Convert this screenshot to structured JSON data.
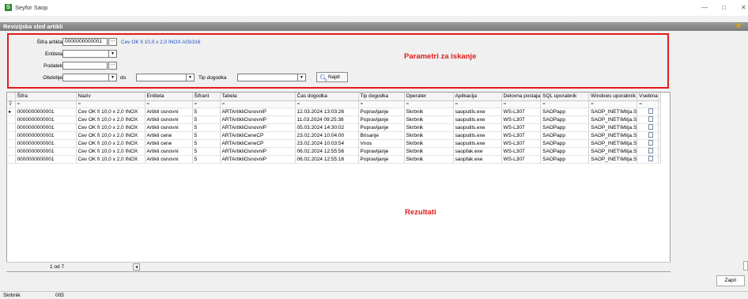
{
  "window": {
    "app_name": "Seyfor Saop",
    "logo_letter": "S"
  },
  "subbar": {
    "title": "Revizijska sled artikli"
  },
  "params": {
    "sifra_label": "Šifra artikla",
    "sifra_value": "0000000000001",
    "sifra_desc": "Cev OK fi 10,0 x 2,0 INOX AISI316",
    "entiteta_label": "Entiteta",
    "podatek_label": "Podatek",
    "obdobje_label": "Obdobje",
    "do_label": "do",
    "tip_label": "Tip dogodka",
    "search_label": "Najdi",
    "annotation": "Parametri za iskanje",
    "dots": "···"
  },
  "grid": {
    "columns": [
      "Šifra",
      "Naziv",
      "Entiteta",
      "Šifrant",
      "Tabela",
      "Čas dogodka",
      "Tip dogodka",
      "Operater",
      "Aplikacija",
      "Delovna postaja",
      "SQL uporabnik",
      "Windows uporabnik",
      "Vsebina"
    ],
    "filter_symbol": "=",
    "rows": [
      [
        "0000000000001",
        "Cev OK fi 10,0 x 2,0 INOX",
        "Artikli osnovni",
        "5",
        "ARTArtikliOsnovniP",
        "12.03.2024 13:03:26",
        "Popravljanje",
        "Skrbnik",
        "saoputils.exe",
        "WS-L307",
        "SAOPapp",
        "SAOP_INET\\Mitja.S"
      ],
      [
        "0000000000001",
        "Cev OK fi 10,0 x 2,0 INOX",
        "Artikli osnovni",
        "5",
        "ARTArtikliOsnovniP",
        "11.03.2024 09:25:38",
        "Popravljanje",
        "Skrbnik",
        "saoputils.exe",
        "WS-L307",
        "SAOPapp",
        "SAOP_INET\\Mitja.S"
      ],
      [
        "0000000000001",
        "Cev OK fi 10,0 x 2,0 INOX",
        "Artikli osnovni",
        "5",
        "ARTArtikliOsnovniP",
        "05.03.2024 14:30:02",
        "Popravljanje",
        "Skrbnik",
        "saoputils.exe",
        "WS-L307",
        "SAOPapp",
        "SAOP_INET\\Mitja.S"
      ],
      [
        "0000000000001",
        "Cev OK fi 10,0 x 2,0 INOX",
        "Artikli cene",
        "5",
        "ARTArtikliCeneCP",
        "23.02.2024 10:04:00",
        "Brisanje",
        "Skrbnik",
        "saoputils.exe",
        "WS-L307",
        "SAOPapp",
        "SAOP_INET\\Mitja.S"
      ],
      [
        "0000000000001",
        "Cev OK fi 10,0 x 2,0 INOX",
        "Artikli cene",
        "5",
        "ARTArtikliCeneCP",
        "23.02.2024 10:03:54",
        "Vnos",
        "Skrbnik",
        "saoputils.exe",
        "WS-L307",
        "SAOPapp",
        "SAOP_INET\\Mitja.S"
      ],
      [
        "0000000000001",
        "Cev OK fi 10,0 x 2,0 INOX",
        "Artikli osnovni",
        "5",
        "ARTArtikliOsnovniP",
        "06.02.2024 12:55:56",
        "Popravljanje",
        "Skrbnik",
        "saopfak.exe",
        "WS-L307",
        "SAOPapp",
        "SAOP_INET\\Mitja.S"
      ],
      [
        "0000000000001",
        "Cev OK fi 10,0 x 2,0 INOX",
        "Artikli osnovni",
        "5",
        "ARTArtikliOsnovniP",
        "06.02.2024 12:55:16",
        "Popravljanje",
        "Skrbnik",
        "saopfak.exe",
        "WS-L307",
        "SAOPapp",
        "SAOP_INET\\Mitja.S"
      ]
    ],
    "annotation": "Rezultati"
  },
  "pager": {
    "text": "1 od 7",
    "arrow": "◂"
  },
  "actions": {
    "close_label": "Zapri"
  },
  "status": {
    "user": "Skrbnik",
    "code": "005"
  },
  "colors": {
    "accent_red": "#e31b1b",
    "link_blue": "#1f4fc0"
  }
}
